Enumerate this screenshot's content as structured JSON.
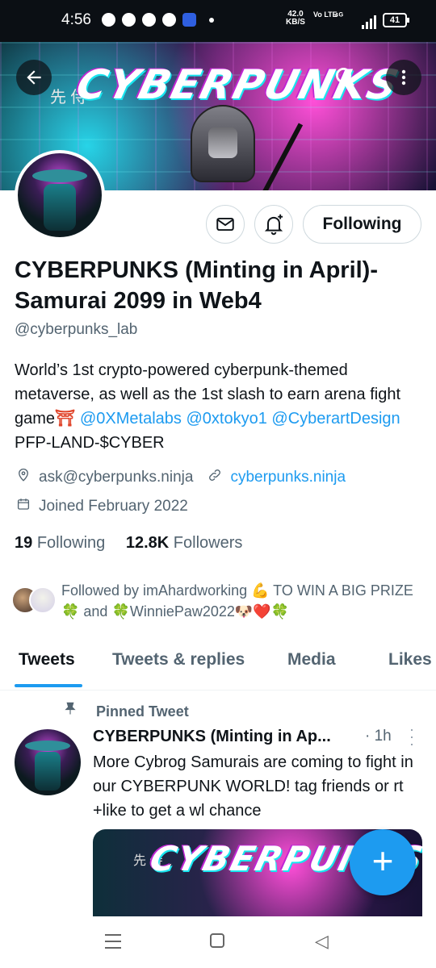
{
  "status_bar": {
    "time": "4:56",
    "net_speed": "42.0",
    "net_unit": "KB/S",
    "volte": "Vo LTE",
    "signal": "⁴ᴳ",
    "battery": "41"
  },
  "banner": {
    "title": "CYBERPUNKS",
    "kanji": "先 侍"
  },
  "profile": {
    "message_icon": "✉",
    "bell_icon": "🔔",
    "follow_label": "Following",
    "name": "CYBERPUNKS (Minting in April)-Samurai 2099 in Web4",
    "handle": "@cyberpunks_lab",
    "bio_text": "World’s 1st crypto-powered cyberpunk-themed metaverse, as well as the 1st slash to earn arena fight game",
    "bio_emoji": "⛩",
    "bio_link1": "@0XMetalabs",
    "bio_link2": "@0xtokyo1",
    "bio_link3": "@CyberartDesign",
    "bio_suffix": "PFP-LAND-$CYBER",
    "email": "ask@cyberpunks.ninja",
    "website": "cyberpunks.ninja",
    "joined": "Joined February 2022",
    "following_count": "19",
    "following_label": "Following",
    "followers_count": "12.8K",
    "followers_label": "Followers",
    "followed_by": "Followed by imAhardworking 💪 TO WIN A BIG PRIZE 🍀 and 🍀WinniePaw2022🐶❤️🍀"
  },
  "tabs": [
    "Tweets",
    "Tweets & replies",
    "Media",
    "Likes"
  ],
  "tweet": {
    "pinned_label": "Pinned Tweet",
    "author": "CYBERPUNKS (Minting in Ap...",
    "time": "· 1h",
    "text": "More Cybrog Samurais are coming to fight in our CYBERPUNK WORLD! tag friends or rt +like to get a wl chance",
    "media_title": "CYBERPUNKS",
    "media_kanji": "先 侍"
  },
  "fab_label": "+",
  "icons": {
    "back": "arrow-left-icon",
    "search": "search-icon",
    "more": "more-vertical-icon",
    "location": "location-icon",
    "link": "link-icon",
    "calendar": "calendar-icon",
    "pin": "pin-icon"
  },
  "colors": {
    "accent": "#1d9bf0",
    "text": "#0f1419",
    "muted": "#536471"
  }
}
